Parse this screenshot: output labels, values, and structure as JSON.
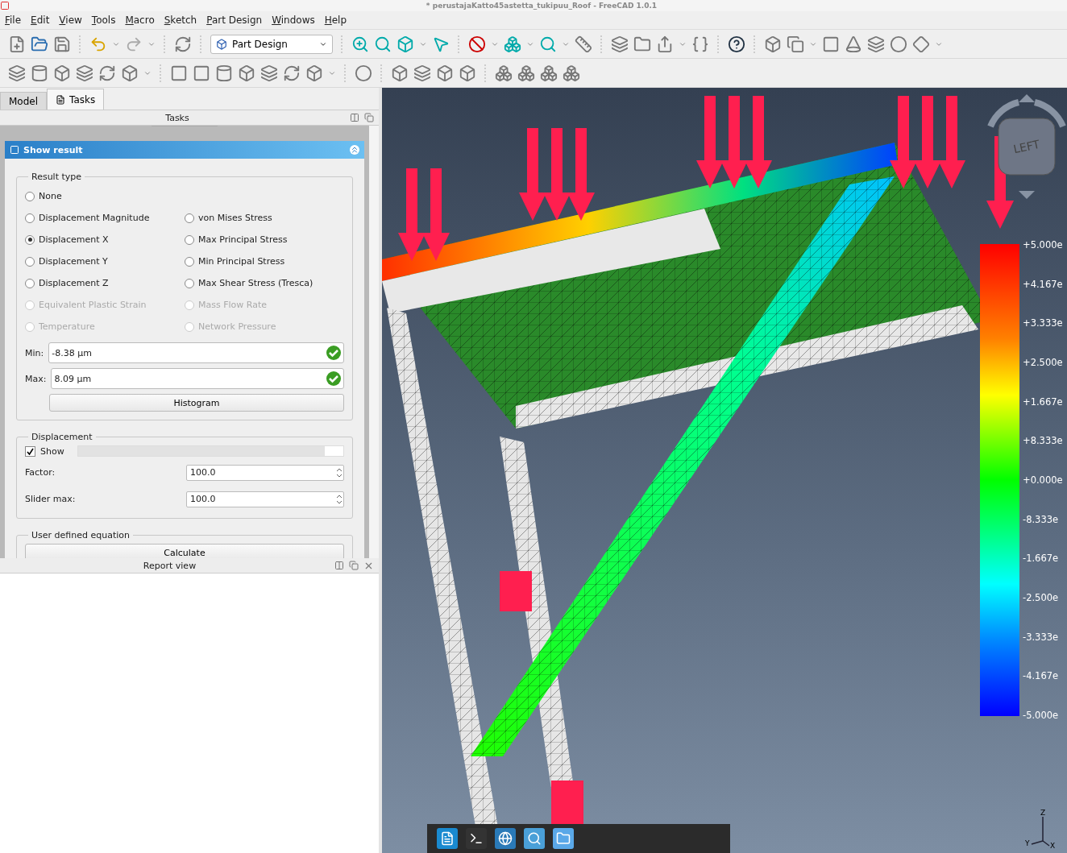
{
  "window": {
    "title": "* perustajaKatto45astetta_tukipuu_Roof - FreeCAD 1.0.1"
  },
  "menu": [
    "File",
    "Edit",
    "View",
    "Tools",
    "Macro",
    "Sketch",
    "Part Design",
    "Windows",
    "Help"
  ],
  "workbench": "Part Design",
  "tabs": [
    {
      "label": "Model",
      "selected": false
    },
    {
      "label": "Tasks",
      "selected": true
    }
  ],
  "tasks_panel": {
    "title": "Tasks"
  },
  "task_box": {
    "title": "Show result",
    "expanded": true,
    "result_type": {
      "title": "Result type",
      "left": [
        {
          "label": "None",
          "selected": false,
          "disabled": false
        },
        {
          "label": "Displacement Magnitude",
          "selected": false,
          "disabled": false
        },
        {
          "label": "Displacement X",
          "selected": true,
          "disabled": false
        },
        {
          "label": "Displacement Y",
          "selected": false,
          "disabled": false
        },
        {
          "label": "Displacement Z",
          "selected": false,
          "disabled": false
        },
        {
          "label": "Equivalent Plastic Strain",
          "selected": false,
          "disabled": true
        },
        {
          "label": "Temperature",
          "selected": false,
          "disabled": true
        }
      ],
      "right": [
        {
          "label": "von Mises Stress",
          "selected": false,
          "disabled": false
        },
        {
          "label": "Max Principal Stress",
          "selected": false,
          "disabled": false
        },
        {
          "label": "Min Principal Stress",
          "selected": false,
          "disabled": false
        },
        {
          "label": "Max Shear Stress (Tresca)",
          "selected": false,
          "disabled": false
        },
        {
          "label": "Mass Flow Rate",
          "selected": false,
          "disabled": true
        },
        {
          "label": "Network Pressure",
          "selected": false,
          "disabled": true
        }
      ],
      "min": {
        "label": "Min:",
        "value": "-8.38 µm"
      },
      "max": {
        "label": "Max:",
        "value": "8.09 µm"
      },
      "histogram": "Histogram"
    },
    "displacement": {
      "title": "Displacement",
      "show": {
        "label": "Show",
        "checked": true
      },
      "level": 0.93,
      "factor": {
        "label": "Factor:",
        "value": "100.0"
      },
      "slider_max": {
        "label": "Slider max:",
        "value": "100.0"
      }
    },
    "equation": {
      "title": "User defined equation",
      "button": "Calculate"
    }
  },
  "report_view": {
    "title": "Report view"
  },
  "viewport": {
    "nav_cube": "LEFT",
    "legend": [
      "+5.000e",
      "+4.167e",
      "+3.333e",
      "+2.500e",
      "+1.667e",
      "+8.333e",
      "+0.000e",
      "-8.333e",
      "-1.667e",
      "-2.500e",
      "-3.333e",
      "-4.167e",
      "-5.000e"
    ],
    "axes": [
      "Z",
      "X",
      "Y"
    ]
  }
}
